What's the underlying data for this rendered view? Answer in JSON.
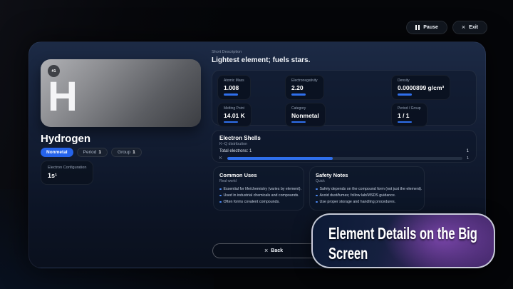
{
  "topbar": {
    "pause_label": "Pause",
    "exit_label": "Exit",
    "exit_icon": "×"
  },
  "element": {
    "number_badge": "#1",
    "symbol": "H",
    "name": "Hydrogen",
    "category_badge": "Nonmetal",
    "period_label": "Period",
    "period_value": "1",
    "group_label": "Group",
    "group_value": "1",
    "electron_config_label": "Electron Configuration",
    "electron_config_value": "1s¹"
  },
  "description": {
    "label": "Short Description",
    "text": "Lightest element; fuels stars."
  },
  "stats": [
    {
      "label": "Atomic Mass",
      "value": "1.008"
    },
    {
      "label": "Electronegativity",
      "value": "2.20"
    },
    {
      "label": "Density",
      "value": "0.0000899 g/cm³"
    },
    {
      "label": "Melting Point",
      "value": "14.01 K"
    },
    {
      "label": "Category",
      "value": "Nonmetal"
    },
    {
      "label": "Period / Group",
      "value": "1 / 1"
    }
  ],
  "shells": {
    "title": "Electron Shells",
    "subtitle": "K–Q distribution",
    "total_label": "Total electrons: 1",
    "total_value": "1",
    "rows": [
      {
        "shell": "K",
        "count": "1",
        "fill": "45%"
      }
    ]
  },
  "common_uses": {
    "title": "Common Uses",
    "subtitle": "Real-world",
    "items": [
      "Essential for life/chemistry (varies by element).",
      "Used in industrial chemicals and compounds.",
      "Often forms covalent compounds."
    ]
  },
  "safety_notes": {
    "title": "Safety Notes",
    "subtitle": "Quick",
    "items": [
      "Safety depends on the compound form (not just the element).",
      "Avoid dust/fumes; follow lab/MSDS guidance.",
      "Use proper storage and handling procedures."
    ]
  },
  "back_button": {
    "icon": "×",
    "label": "Back"
  },
  "caption": {
    "text": "Element Details on the Big Screen"
  },
  "colors": {
    "accent_blue": "#2f6feb",
    "badge_blue": "#2563eb",
    "banner_purple": "#4b2c73",
    "panel_navy": "#141f36"
  }
}
